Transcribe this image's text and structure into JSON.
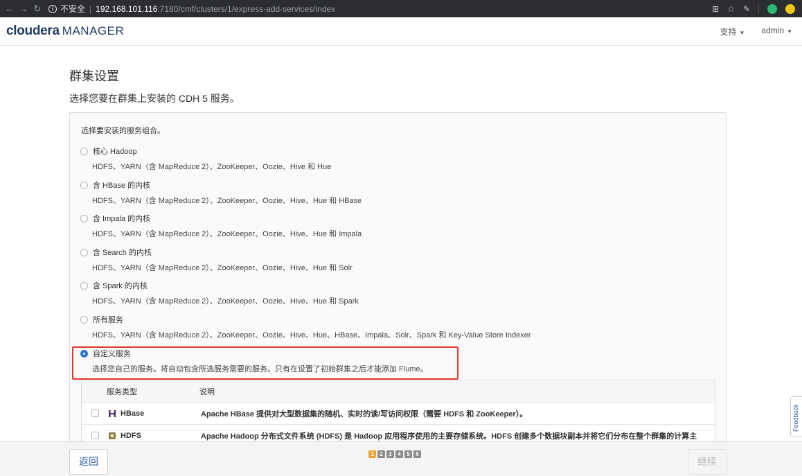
{
  "browser": {
    "insecure_label": "不安全",
    "url_host": "192.168.101.116",
    "url_path": ":7180/cmf/clusters/1/express-add-services/index"
  },
  "header": {
    "brand": "cloudera",
    "product": "MANAGER",
    "support_label": "支持",
    "user_label": "admin"
  },
  "page": {
    "title": "群集设置",
    "subtitle": "选择您要在群集上安装的 CDH 5 服务。",
    "intro": "选择要安装的服务组合。"
  },
  "options": [
    {
      "label": "核心 Hadoop",
      "desc": "HDFS、YARN（含 MapReduce 2）、ZooKeeper、Oozie、Hive 和 Hue",
      "checked": false
    },
    {
      "label": "含 HBase 的内核",
      "desc": "HDFS、YARN（含 MapReduce 2）、ZooKeeper、Oozie、Hive、Hue 和 HBase",
      "checked": false
    },
    {
      "label": "含 Impala 的内核",
      "desc": "HDFS、YARN（含 MapReduce 2）、ZooKeeper、Oozie、Hive、Hue 和 Impala",
      "checked": false
    },
    {
      "label": "含 Search 的内核",
      "desc": "HDFS、YARN（含 MapReduce 2）、ZooKeeper、Oozie、Hive、Hue 和 Solr",
      "checked": false
    },
    {
      "label": "含 Spark 的内核",
      "desc": "HDFS、YARN（含 MapReduce 2）、ZooKeeper、Oozie、Hive、Hue 和 Spark",
      "checked": false
    },
    {
      "label": "所有服务",
      "desc": "HDFS、YARN（含 MapReduce 2）、ZooKeeper、Oozie、Hive、Hue、HBase、Impala、Solr、Spark 和 Key-Value Store Indexer",
      "checked": false
    },
    {
      "label": "自定义服务",
      "desc": "选择您自己的服务。将自动包含所选服务需要的服务。只有在设置了初始群集之后才能添加 Flume。",
      "checked": true
    }
  ],
  "table": {
    "col_type": "服务类型",
    "col_desc": "说明",
    "rows": [
      {
        "name": "HBase",
        "icon": "hbase-icon",
        "desc": "Apache HBase 提供对大型数据集的随机、实时的读/写访问权限（需要 HDFS 和 ZooKeeper）。"
      },
      {
        "name": "HDFS",
        "icon": "hdfs-icon",
        "desc": "Apache Hadoop 分布式文件系统 (HDFS) 是 Hadoop 应用程序使用的主要存储系统。HDFS 创建多个数据块副本并将它们分布在整个群集的计算主"
      }
    ]
  },
  "footer": {
    "back_label": "返回",
    "next_label": "继续",
    "steps": [
      "1",
      "2",
      "3",
      "4",
      "5",
      "6"
    ],
    "current_step": "1"
  },
  "feedback_label": "Feedback",
  "colors": {
    "accent": "#2a72d8",
    "highlight": "#e1372e",
    "step_active": "#f0a430",
    "brand": "#1e3a63"
  }
}
